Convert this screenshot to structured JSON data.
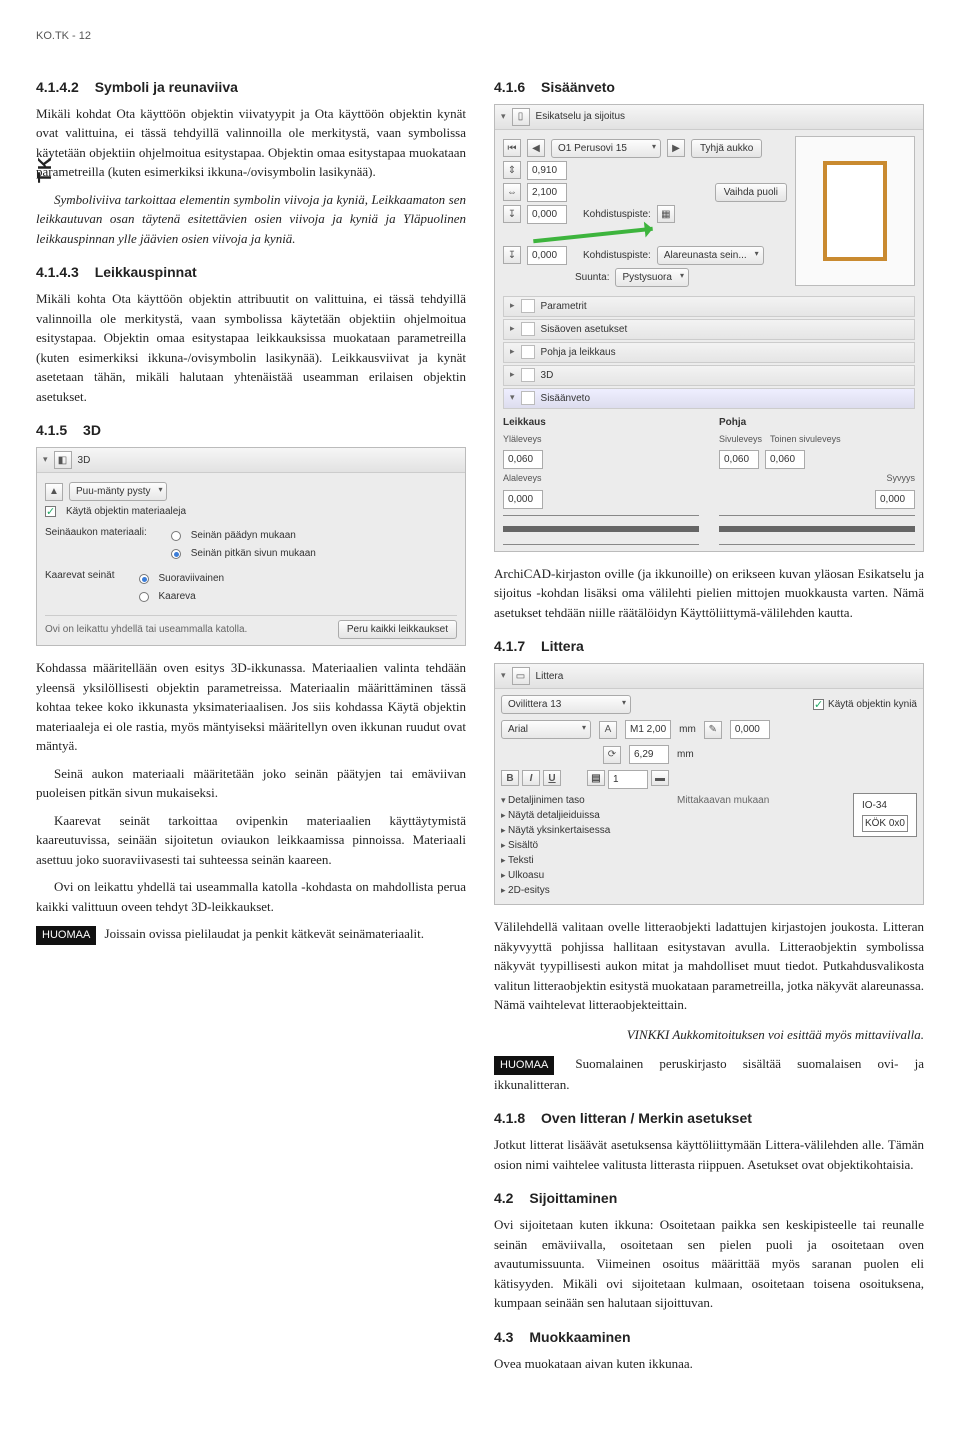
{
  "header": {
    "code": "KO.TK - 12"
  },
  "tab": "TK",
  "left": {
    "s4142": {
      "title_num": "4.1.4.2",
      "title": "Symboli ja reunaviiva",
      "p1": "Mikäli kohdat Ota käyttöön objektin viivatyypit ja Ota käyttöön objektin kynät ovat valittuina, ei tässä tehdyillä valinnoilla ole merkitystä, vaan symbolissa käytetään objektiin ohjelmoitua esitystapaa. Objektin omaa esitystapaa muokataan parametreilla (kuten esimerkiksi ikkuna-/ovisymbolin lasikynää).",
      "p2": "Symboliviiva tarkoittaa elementin symbolin viivoja ja kyniä, Leikkaamaton sen leikkautuvan osan täytenä esitettävien osien viivoja ja kyniä ja Yläpuolinen leikkauspinnan ylle jäävien osien viivoja ja kyniä."
    },
    "s4143": {
      "title_num": "4.1.4.3",
      "title": "Leikkauspinnat",
      "p1": "Mikäli kohta Ota käyttöön objektin attribuutit on valittuina, ei tässä tehdyillä valinnoilla ole merkitystä, vaan symbolissa käytetään objektiin ohjelmoitua esitystapaa. Objektin omaa esitystapaa leikkauksissa muokataan parametreilla (kuten esimerkiksi ikkuna-/ovisymbolin lasikynää). Leikkausviivat ja kynät asetetaan tähän, mikäli halutaan yhtenäistää useamman erilaisen objektin asetukset."
    },
    "s415": {
      "title_num": "4.1.5",
      "title": "3D",
      "shot": {
        "header": "3D",
        "material_dd": "Puu-mänty pysty",
        "chk_label": "Käytä objektin materiaaleja",
        "wall_label": "Seinäaukon materiaali:",
        "r1": "Seinän päädyn mukaan",
        "r2": "Seinän pitkän sivun mukaan",
        "curve_label": "Kaarevat seinät",
        "r3": "Suoraviivainen",
        "r4": "Kaareva",
        "footer_left": "Ovi on leikattu yhdellä tai useammalla katolla.",
        "footer_btn": "Peru kaikki leikkaukset"
      },
      "p1": "Kohdassa määritellään oven esitys 3D-ikkunassa. Materiaalien valinta tehdään yleensä yksilöllisesti objektin parametreissa. Materiaalin määrittäminen tässä kohtaa tekee koko ikkunasta yksimateriaalisen. Jos siis kohdassa Käytä objektin materiaaleja ei ole rastia, myös mäntyiseksi määritellyn oven ikkunan ruudut ovat mäntyä.",
      "p2": "Seinä aukon materiaali määritetään joko seinän päätyjen tai emäviivan puoleisen pitkän sivun mukaiseksi.",
      "p3": "Kaarevat seinät tarkoittaa ovipenkin materiaalien käyttäytymistä kaareutuvissa, seinään sijoitetun oviaukon leikkaamissa pinnoissa. Materiaali asettuu joko suoraviivasesti tai suhteessa seinän kaareen.",
      "p4": "Ovi on leikattu yhdellä tai useammalla katolla -kohdasta on mahdollista perua kaikki valittuun oveen tehdyt 3D-leikkaukset.",
      "note_label": "HUOMAA",
      "note_text": "Joissain ovissa pielilaudat ja penkit kätkevät seinämateriaalit."
    }
  },
  "right": {
    "s416": {
      "title_num": "4.1.6",
      "title": "Sisäänveto",
      "shot": {
        "header": "Esikatselu ja sijoitus",
        "dd_title": "O1 Perusovi 15",
        "btn_tyhja": "Tyhjä aukko",
        "v_top": "0,910",
        "v_w": "2,100",
        "vahda": "Vaihda puoli",
        "v_k1": "0,000",
        "kohd_label": "Kohdistuspiste:",
        "v_k2": "0,000",
        "kohd_dd_label": "Kohdistuspiste:",
        "kohd_dd": "Alareunasta sein...",
        "suunta_label": "Suunta:",
        "suunta_dd": "Pystysuora",
        "rows": {
          "param": "Parametrit",
          "sisaoven": "Sisäoven asetukset",
          "pohja": "Pohja ja leikkaus",
          "d3": "3D",
          "sisaanveto": "Sisäänveto"
        },
        "leikkaus_h": "Leikkaus",
        "pohja_h": "Pohja",
        "ylaleveys": "Yläleveys",
        "sivuleveys": "Sivuleveys",
        "toinen": "Toinen sivuleveys",
        "alaleveys": "Alaleveys",
        "syvyys": "Syvyys",
        "val1": "0,060",
        "val2": "0,060",
        "val3": "0,060",
        "val4": "0,000",
        "val5": "0,000"
      },
      "caption": "ArchiCAD-kirjaston oville (ja ikkunoille) on erikseen kuvan yläosan Esikatselu ja sijoitus -kohdan lisäksi oma välilehti pielien mittojen muokkausta varten. Nämä asetukset tehdään niille räätälöidyn Käyttöliittymä-välilehden kautta."
    },
    "s417": {
      "title_num": "4.1.7",
      "title": "Littera",
      "shot": {
        "header": "Littera",
        "dd_obj": "Ovilittera 13",
        "chk_label": "Käytä objektin kyniä",
        "font": "Arial",
        "m_val": "M1  2,00",
        "mm": "mm",
        "pen_val": "0,000",
        "h_val": "6,29",
        "style_B": "B",
        "style_I": "I",
        "style_U": "U",
        "align": "▤",
        "tree": {
          "t1": "Detaljinimen taso",
          "t2": "Näytä detaljieiduissa",
          "t3": "Näytä yksinkertaisessa",
          "t4": "Sisältö",
          "t5": "Teksti",
          "t6": "Ulkoasu",
          "t7": "2D-esitys"
        },
        "mittak": "Mittakaavan mukaan",
        "box_l1": "IO-34",
        "box_l2": "KÖK  0x0"
      },
      "p1": "Välilehdellä valitaan ovelle litteraobjekti ladattujen kirjastojen joukosta. Litteran näkyvyyttä pohjissa hallitaan esitystavan avulla. Litteraobjektin symbolissa näkyvät tyypillisesti aukon mitat ja mahdolliset muut tiedot. Putkahdusvalikosta valitun litteraobjektin esitystä muokataan parametreilla, jotka näkyvät alareunassa. Nämä vaihtelevat litteraobjekteittain.",
      "vinkki": "VINKKI Aukkomitoituksen voi esittää myös mittaviivalla.",
      "note_label": "HUOMAA",
      "note_text": "Suomalainen peruskirjasto sisältää suomalaisen ovi- ja ikkunalitteran."
    },
    "s418": {
      "title_num": "4.1.8",
      "title": "Oven litteran / Merkin asetukset",
      "p1": "Jotkut litterat lisäävät asetuksensa käyttöliittymään Littera-välilehden alle. Tämän osion nimi vaihtelee valitusta litterasta riippuen. Asetukset ovat objektikohtaisia."
    },
    "s42": {
      "title_num": "4.2",
      "title": "Sijoittaminen",
      "p1": "Ovi sijoitetaan kuten ikkuna: Osoitetaan paikka sen keskipisteelle tai reunalle seinän emäviivalla, osoitetaan sen pielen puoli ja osoitetaan oven avautumissuunta. Viimeinen osoitus määrittää myös saranan puolen eli kätisyyden. Mikäli ovi sijoitetaan kulmaan, osoitetaan toisena osoituksena, kumpaan seinään sen halutaan sijoittuvan."
    },
    "s43": {
      "title_num": "4.3",
      "title": "Muokkaaminen",
      "p1": "Ovea muokataan aivan kuten ikkunaa."
    }
  }
}
